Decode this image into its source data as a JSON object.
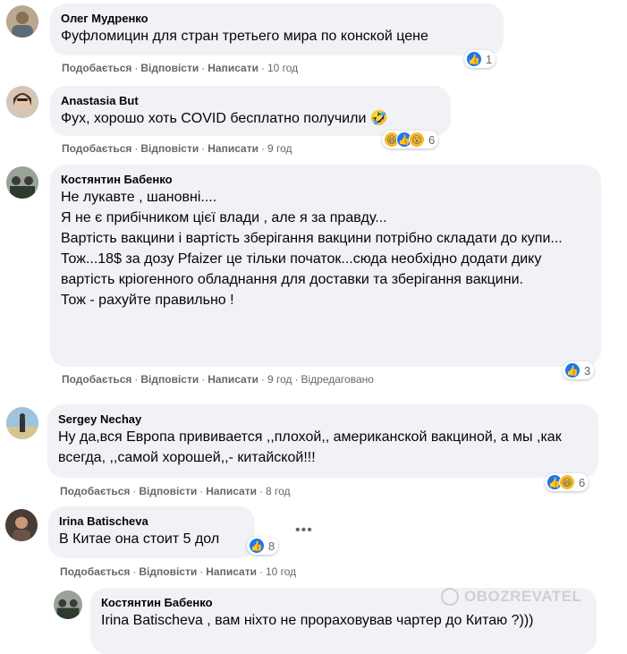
{
  "comments": [
    {
      "author": "Олег Мудренко",
      "text": "Фуфломицин для стран третьего мира по конской цене",
      "actions": {
        "like": "Подобається",
        "reply": "Відповісти",
        "write": "Написати",
        "time": "10 год"
      },
      "reaction_count": "1"
    },
    {
      "author": "Anastasia But",
      "text": "Фух, хорошо хоть COVID бесплатно получили 🤣",
      "actions": {
        "like": "Подобається",
        "reply": "Відповісти",
        "write": "Написати",
        "time": "9 год"
      },
      "reaction_count": "6"
    },
    {
      "author": "Костянтин Бабенко",
      "text": "Не лукавте , шановні....\nЯ не є прибічником цієї влади , але я за правду...\nВартість вакцини і вартість зберігання вакцини потрібно складати до купи...\nТож...18$ за дозу Pfaizer це тільки початок...сюда необхідно додати дику вартість кріогенного обладнання для доставки та зберігання вакцини.\nТож - рахуйте правильно !",
      "actions": {
        "like": "Подобається",
        "reply": "Відповісти",
        "write": "Написати",
        "time": "9 год",
        "edited": "Відредаговано"
      },
      "reaction_count": "3"
    },
    {
      "author": "Sergey Nechay",
      "text": "Ну да,вся Европа прививается ,,плохой,, американской вакциной, а мы ,как всегда, ,,самой хорошей,,- китайской!!!",
      "actions": {
        "like": "Подобається",
        "reply": "Відповісти",
        "write": "Написати",
        "time": "8 год"
      },
      "reaction_count": "6"
    },
    {
      "author": "Irina Batischeva",
      "text": "В Китае она стоит 5 дол",
      "actions": {
        "like": "Подобається",
        "reply": "Відповісти",
        "write": "Написати",
        "time": "10 год"
      },
      "reaction_count": "8"
    },
    {
      "author": "Костянтин Бабенко",
      "text": "Irina Batischeva , вам ніхто не прораховував чартер до Китаю ?)))"
    }
  ],
  "watermark": "OBOZREVATEL",
  "icons": {
    "like": "like-reaction-icon",
    "haha": "haha-reaction-icon",
    "wow": "wow-reaction-icon",
    "more": "more-options-icon"
  },
  "colors": {
    "bubble": "#f0f2f5",
    "like": "#1877f2",
    "secondary_text": "#65676b"
  }
}
